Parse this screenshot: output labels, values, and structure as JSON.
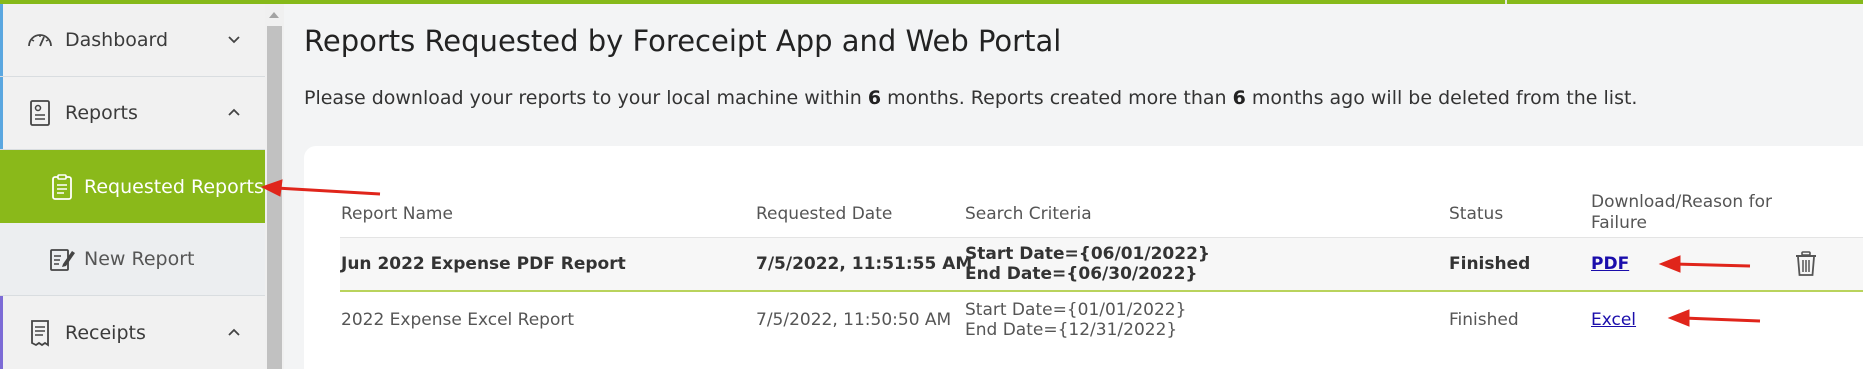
{
  "sidebar": {
    "items": [
      {
        "label": "Dashboard",
        "icon": "gauge-icon",
        "chevron": "chevron-down-icon",
        "accent": "#5aa7e0"
      },
      {
        "label": "Reports",
        "icon": "report-icon",
        "chevron": "chevron-up-icon",
        "accent": "#5aa7e0"
      },
      {
        "label": "Requested Reports",
        "icon": "clipboard-icon",
        "active": true
      },
      {
        "label": "New Report",
        "icon": "edit-document-icon"
      },
      {
        "label": "Receipts",
        "icon": "receipt-icon",
        "chevron": "chevron-up-icon",
        "accent": "#7c6bd6"
      }
    ]
  },
  "page": {
    "title": "Reports Requested by Foreceipt App and Web Portal",
    "notice_pre": "Please download your reports to your local machine within ",
    "notice_n1": "6",
    "notice_mid": " months. Reports created more than ",
    "notice_n2": "6",
    "notice_post": " months ago will be deleted from the list."
  },
  "table": {
    "headers": {
      "name": "Report Name",
      "date": "Requested Date",
      "criteria": "Search Criteria",
      "status": "Status",
      "download_line1": "Download/Reason for",
      "download_line2": "Failure"
    },
    "rows": [
      {
        "name": "Jun 2022 Expense PDF Report",
        "date": "7/5/2022, 11:51:55 AM",
        "criteria_start": "Start Date={06/01/2022}",
        "criteria_end": "End Date={06/30/2022}",
        "status": "Finished",
        "download": "PDF"
      },
      {
        "name": "2022 Expense Excel Report",
        "date": "7/5/2022, 11:50:50 AM",
        "criteria_start": "Start Date={01/01/2022}",
        "criteria_end": "End Date={12/31/2022}",
        "status": "Finished",
        "download": "Excel"
      }
    ]
  },
  "colors": {
    "brand_green": "#86b91a",
    "annotation_red": "#e0251b"
  }
}
